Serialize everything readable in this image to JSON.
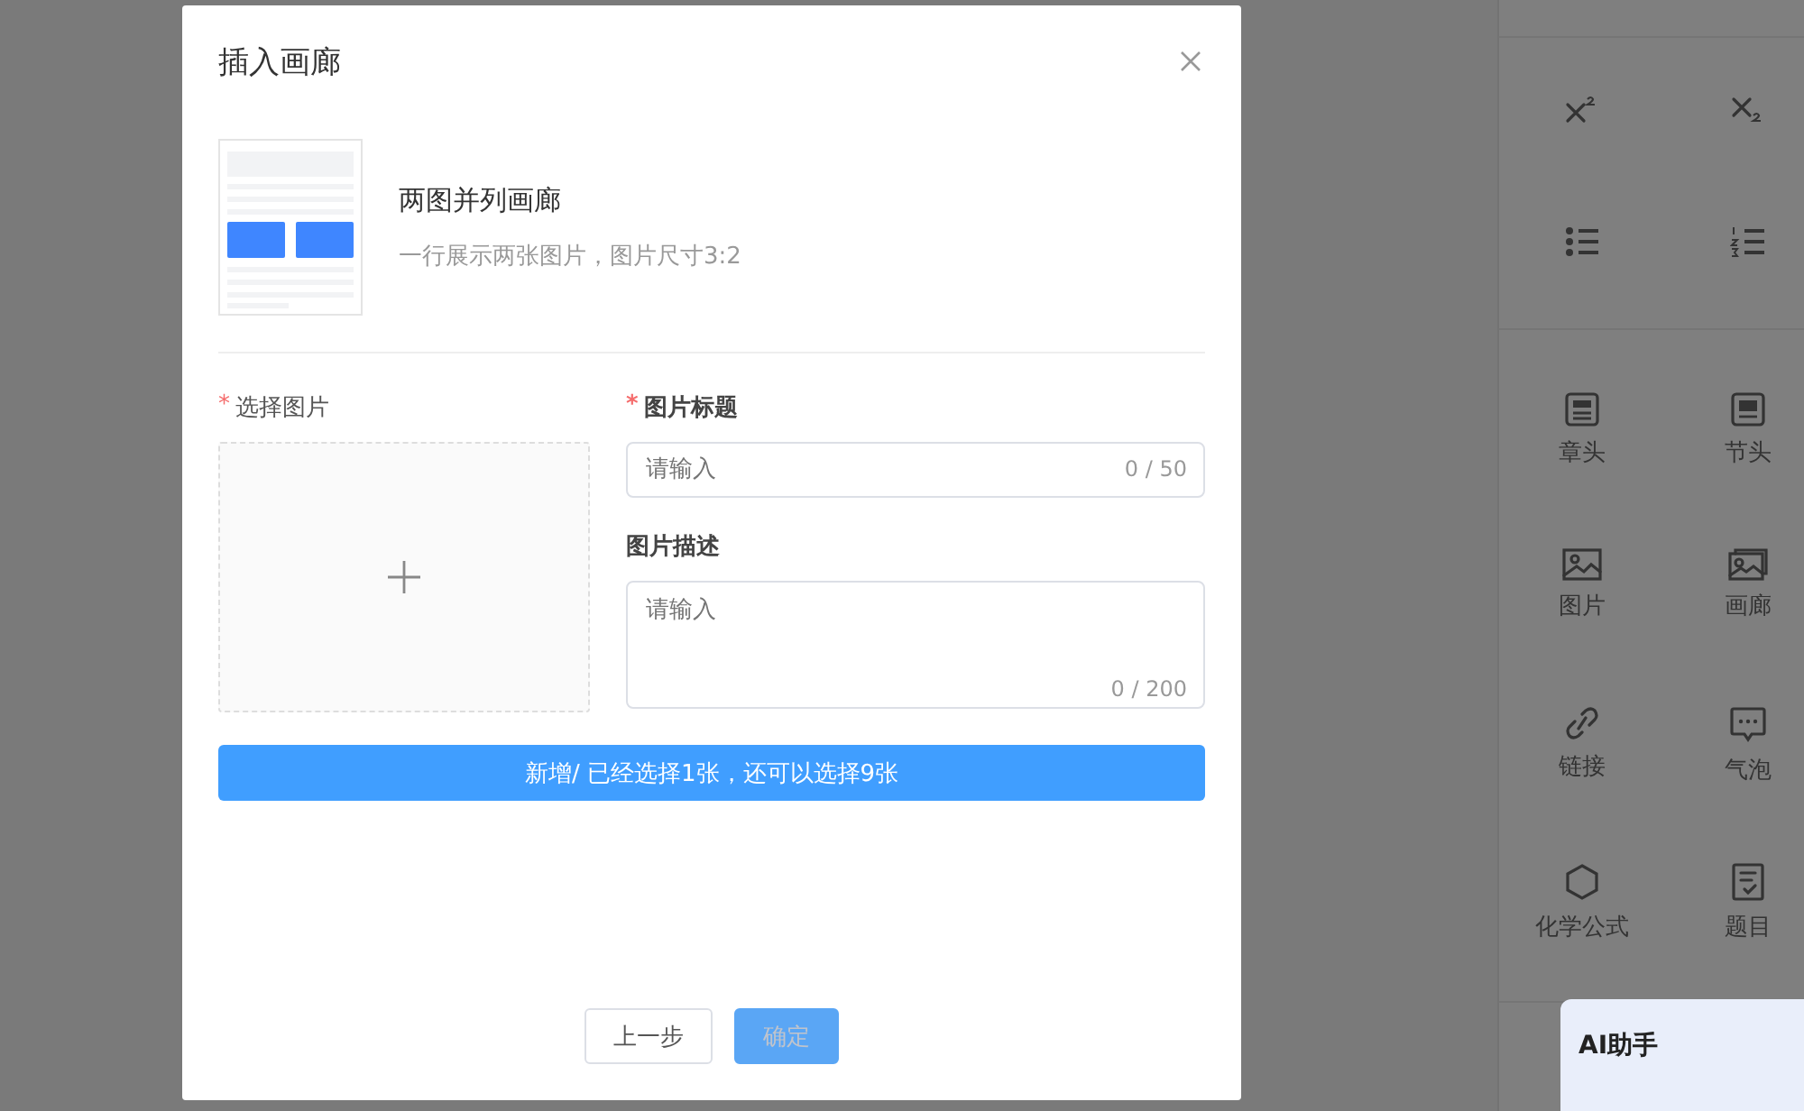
{
  "sidebar": {
    "format_buttons": [
      {
        "kind": "superscript"
      },
      {
        "kind": "subscript"
      },
      {
        "kind": "bullet-list"
      },
      {
        "kind": "numbered-list"
      }
    ],
    "tools": [
      {
        "label": "章头",
        "kind": "chapter"
      },
      {
        "label": "节头",
        "kind": "section"
      },
      {
        "label": "图片",
        "kind": "image"
      },
      {
        "label": "画廊",
        "kind": "gallery"
      },
      {
        "label": "链接",
        "kind": "link"
      },
      {
        "label": "气泡",
        "kind": "bubble"
      },
      {
        "label": "化学公式",
        "kind": "hexagon"
      },
      {
        "label": "题目",
        "kind": "question"
      }
    ],
    "ai_panel": {
      "title": "AI助手"
    }
  },
  "dialog": {
    "title": "插入画廊",
    "required_mark": "*",
    "template": {
      "name": "两图并列画廊",
      "description": "一行展示两张图片，图片尺寸3:2"
    },
    "image_field": {
      "label": "选择图片",
      "required": true
    },
    "fields": [
      {
        "label": "图片标题",
        "required": true,
        "kind": "input",
        "placeholder": "请输入",
        "counter": "0 / 50"
      },
      {
        "label": "图片描述",
        "required": false,
        "kind": "textarea",
        "placeholder": "请输入",
        "counter": "0 / 200"
      }
    ],
    "add_button": {
      "label": "新增/ 已经选择1张，还可以选择9张"
    },
    "buttons": [
      {
        "label": "上一步",
        "kind": "default",
        "disabled": false
      },
      {
        "label": "确定",
        "kind": "primary",
        "disabled": true
      }
    ]
  }
}
